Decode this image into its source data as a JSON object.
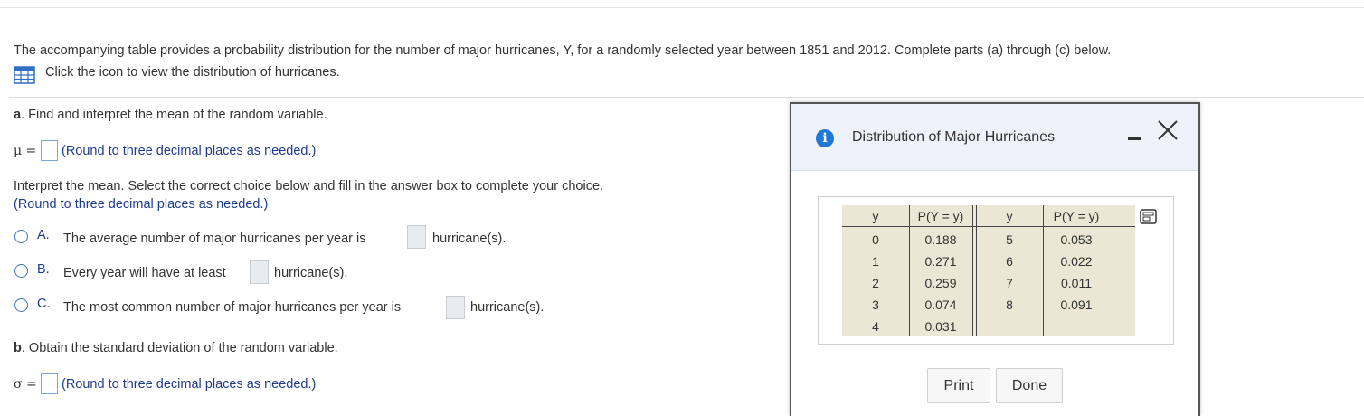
{
  "intro": {
    "text": "The accompanying table provides a probability distribution for the number of major hurricanes, Y, for a randomly selected year between 1851 and 2012. Complete parts (a) through (c) below.",
    "icon_link": "Click the icon to view the distribution of hurricanes.",
    "icon": "table-grid-icon"
  },
  "part_a": {
    "label_letter": "a",
    "label_rest": ". Find and interpret the mean of the random variable.",
    "mu_label": "μ =",
    "round_note": "(Round to three decimal places as needed.)",
    "interpret_prompt": "Interpret the mean. Select the correct choice below and fill in the answer box to complete your choice.",
    "interpret_round": "(Round to three decimal places as needed.)",
    "choices": [
      {
        "letter": "A.",
        "before": "The average number of major hurricanes per year is",
        "after": "hurricane(s)."
      },
      {
        "letter": "B.",
        "before": "Every year will have at least",
        "after": "hurricane(s)."
      },
      {
        "letter": "C.",
        "before": "The most common number of major hurricanes per year is",
        "after": "hurricane(s)."
      }
    ]
  },
  "part_b": {
    "label_letter": "b",
    "label_rest": ". Obtain the standard deviation of the random variable.",
    "sigma_label": "σ =",
    "round_note": "(Round to three decimal places as needed.)"
  },
  "modal": {
    "title": "Distribution of Major Hurricanes",
    "table": {
      "headers": [
        "y",
        "P(Y = y)",
        "y",
        "P(Y = y)"
      ],
      "left": [
        {
          "y": "0",
          "p": "0.188"
        },
        {
          "y": "1",
          "p": "0.271"
        },
        {
          "y": "2",
          "p": "0.259"
        },
        {
          "y": "3",
          "p": "0.074"
        },
        {
          "y": "4",
          "p": "0.031"
        }
      ],
      "right": [
        {
          "y": "5",
          "p": "0.053"
        },
        {
          "y": "6",
          "p": "0.022"
        },
        {
          "y": "7",
          "p": "0.011"
        },
        {
          "y": "8",
          "p": "0.091"
        }
      ]
    },
    "print_label": "Print",
    "done_label": "Done"
  },
  "colors": {
    "link_navy": "#1f3b8f",
    "radio_blue": "#3f74b8",
    "table_bg": "#ece6d4",
    "info_blue": "#1e78d4",
    "modal_header_bg": "#eef3fb"
  }
}
